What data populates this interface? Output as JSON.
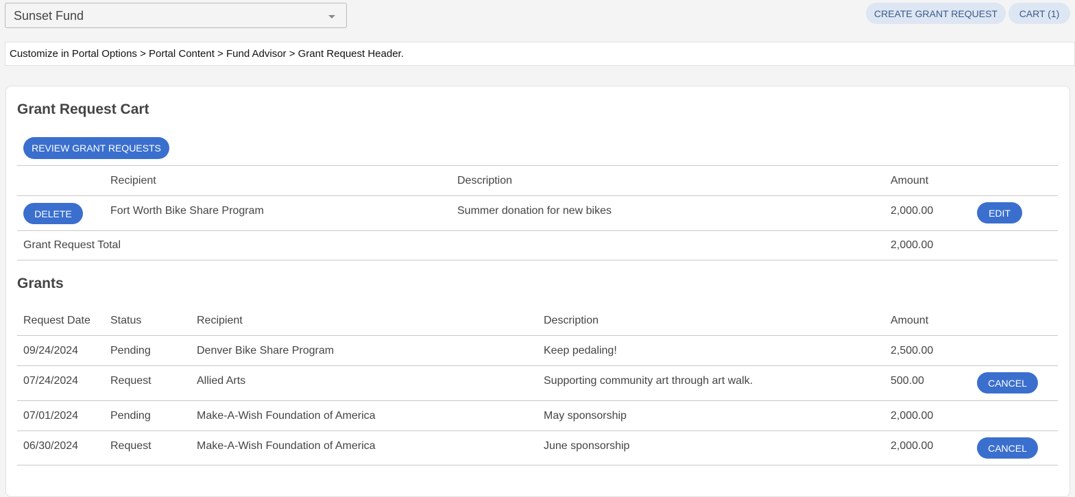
{
  "fund_selector": {
    "value": "Sunset Fund",
    "icon": "chevron-down-icon"
  },
  "top_actions": {
    "create_label": "CREATE GRANT REQUEST",
    "cart_label": "CART (1)"
  },
  "portal_header": {
    "text": "Customize in Portal Options > Portal Content > Fund Advisor > Grant Request Header."
  },
  "cart": {
    "title": "Grant Request Cart",
    "review_label": "REVIEW GRANT REQUESTS",
    "columns": {
      "recipient": "Recipient",
      "description": "Description",
      "amount": "Amount"
    },
    "rows": [
      {
        "delete_label": "DELETE",
        "recipient": "Fort Worth Bike Share Program",
        "description": "Summer donation for new bikes",
        "amount": "2,000.00",
        "edit_label": "EDIT"
      }
    ],
    "total_label": "Grant Request Total",
    "total_amount": "2,000.00"
  },
  "grants": {
    "title": "Grants",
    "columns": {
      "date": "Request Date",
      "status": "Status",
      "recipient": "Recipient",
      "description": "Description",
      "amount": "Amount"
    },
    "rows": [
      {
        "date": "09/24/2024",
        "status": "Pending",
        "recipient": "Denver Bike Share Program",
        "description": "Keep pedaling!",
        "amount": "2,500.00",
        "action": ""
      },
      {
        "date": "07/24/2024",
        "status": "Request",
        "recipient": "Allied Arts",
        "description": "Supporting community art through art walk.",
        "amount": "500.00",
        "action": "CANCEL"
      },
      {
        "date": "07/01/2024",
        "status": "Pending",
        "recipient": "Make-A-Wish Foundation of America",
        "description": "May sponsorship",
        "amount": "2,000.00",
        "action": ""
      },
      {
        "date": "06/30/2024",
        "status": "Request",
        "recipient": "Make-A-Wish Foundation of America",
        "description": "June sponsorship",
        "amount": "2,000.00",
        "action": "CANCEL"
      }
    ]
  },
  "colors": {
    "primary": "#3a6fce",
    "secondary_button": "#dde6f3",
    "background": "#f4f4f4"
  }
}
